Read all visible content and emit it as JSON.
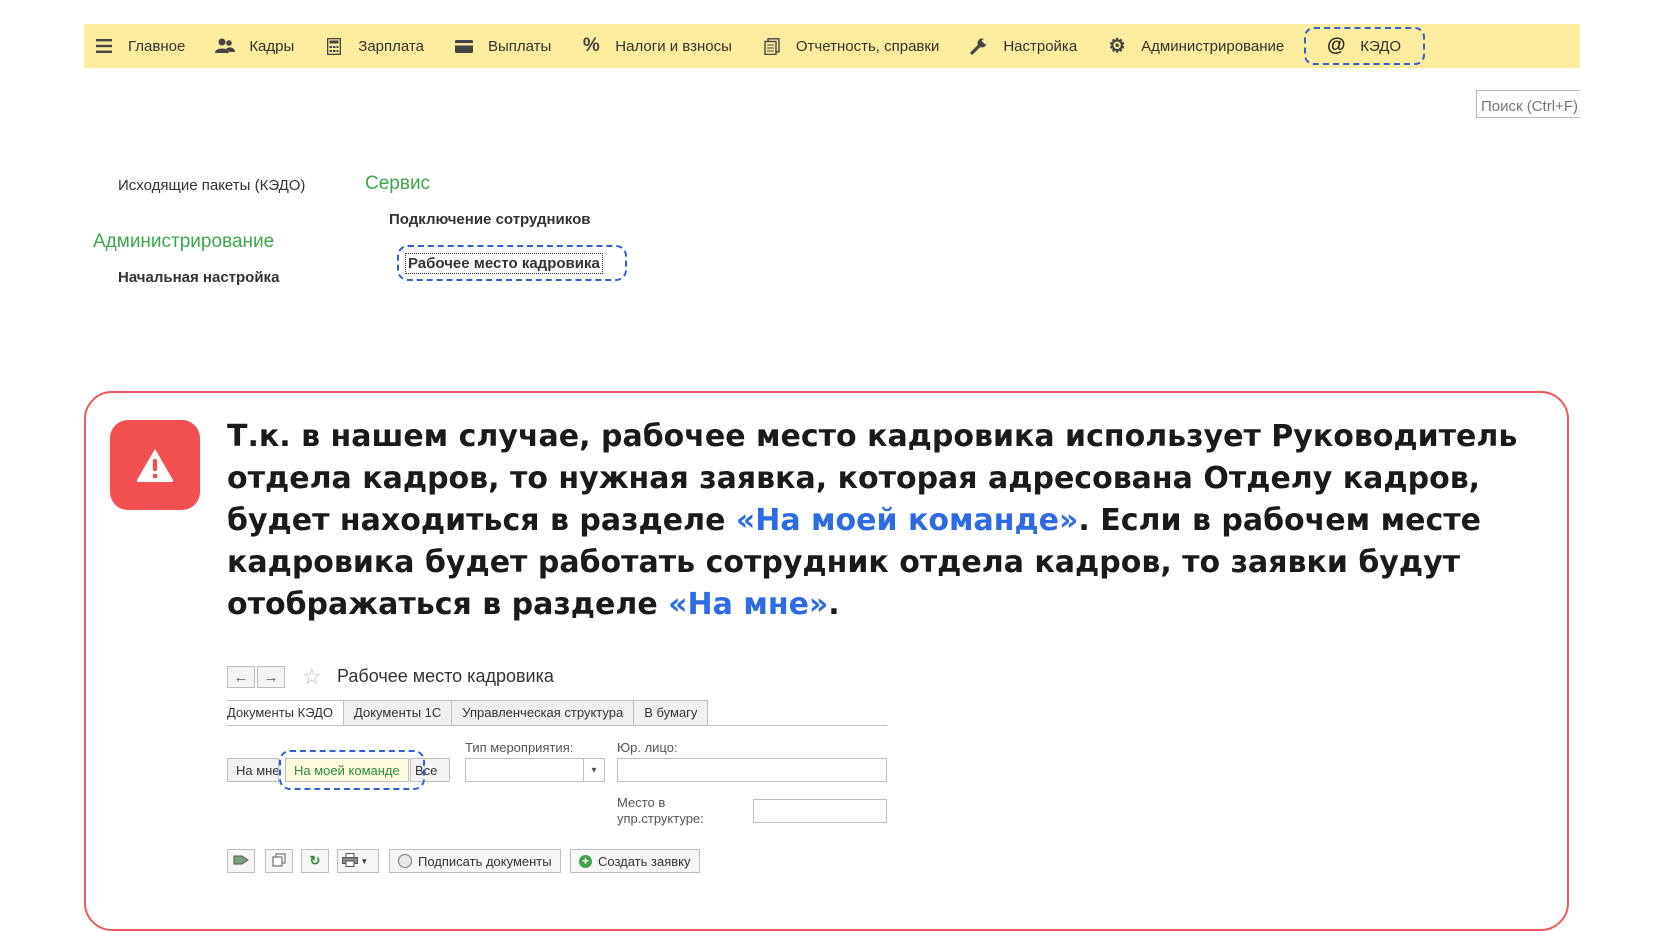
{
  "menu": {
    "items": [
      {
        "label": "Главное",
        "icon": "hamburger-icon"
      },
      {
        "label": "Кадры",
        "icon": "people-icon"
      },
      {
        "label": "Зарплата",
        "icon": "calculator-icon"
      },
      {
        "label": "Выплаты",
        "icon": "wallet-icon"
      },
      {
        "label": "Налоги и взносы",
        "icon": "percent-icon"
      },
      {
        "label": "Отчетность, справки",
        "icon": "documents-icon"
      },
      {
        "label": "Настройка",
        "icon": "wrench-icon"
      },
      {
        "label": "Администрирование",
        "icon": "gear-icon"
      }
    ],
    "kedo": {
      "label": "КЭДО",
      "icon": "at-icon"
    }
  },
  "search": {
    "placeholder": "Поиск (Ctrl+F)"
  },
  "sections": {
    "outgoing_link": "Исходящие пакеты (КЭДО)",
    "service_title": "Сервис",
    "connect_link": "Подключение сотрудников",
    "workplace_link": "Рабочее место кадровика",
    "admin_title": "Администрирование",
    "initial_setup_link": "Начальная настройка"
  },
  "warning": {
    "part1": "Т.к. в нашем случае, рабочее место кадровика использует Руководитель отдела кадров, то нужная заявка, которая адресована Отделу кадров, будет находиться в разделе ",
    "highlight1": "«На моей команде»",
    "part2": ". Если в рабочем месте кадровика будет работать сотрудник отдела кадров, то заявки будут отображаться в разделе ",
    "highlight2": "«На мне»",
    "part3": "."
  },
  "workplace": {
    "title": "Рабочее место кадровика",
    "tabs": [
      "Документы КЭДО",
      "Документы 1С",
      "Управленческая структура",
      "В бумагу"
    ],
    "filters": {
      "on_me": "На мне",
      "on_team": "На моей команде",
      "all": "Все"
    },
    "event_type_label": "Тип мероприятия:",
    "legal_entity_label": "Юр. лицо:",
    "place_label_1": "Место в",
    "place_label_2": "упр.структуре:",
    "sign_docs": "Подписать документы",
    "create_request": "Создать заявку"
  }
}
